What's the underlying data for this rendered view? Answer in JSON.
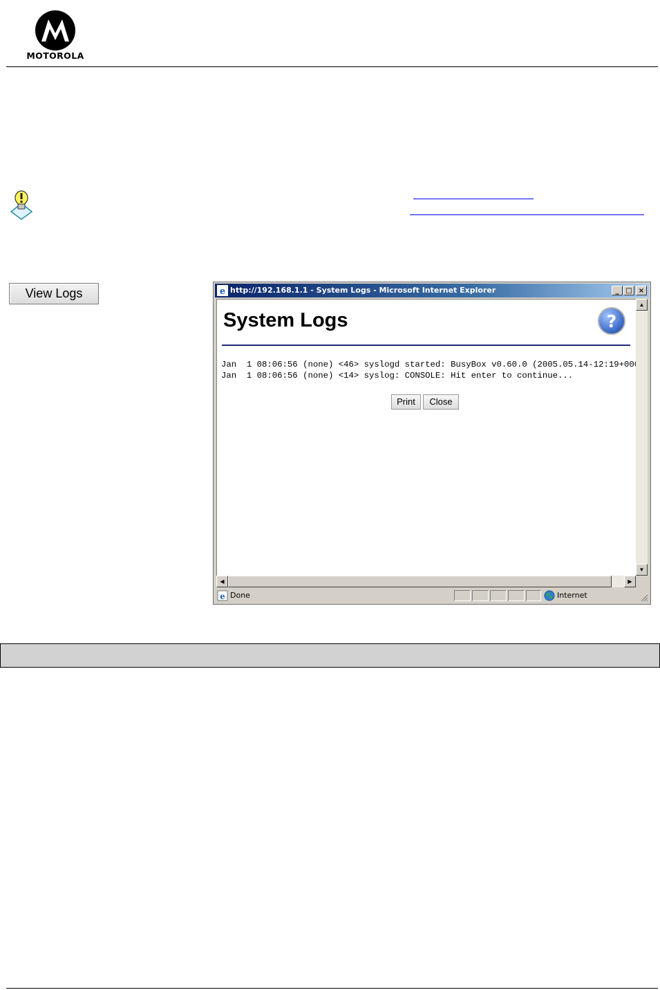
{
  "brand": {
    "name": "MOTOROLA"
  },
  "view_logs_button": {
    "label": "View Logs"
  },
  "browser_window": {
    "title": "http://192.168.1.1 - System Logs - Microsoft Internet Explorer",
    "controls": {
      "minimize": "_",
      "maximize": "□",
      "close": "×"
    },
    "page": {
      "heading": "System Logs",
      "log_lines": [
        "Jan  1 08:06:56 (none) <46> syslogd started: BusyBox v0.60.0 (2005.05.14-12:19+0000",
        "Jan  1 08:06:56 (none) <14> syslog: CONSOLE: Hit enter to continue..."
      ],
      "print_button": "Print",
      "close_button": "Close"
    },
    "scrollbars": {
      "up": "▲",
      "down": "▼",
      "left": "◀",
      "right": "▶"
    },
    "status_bar": {
      "status_text": "Done",
      "zone_text": "Internet"
    }
  },
  "colors": {
    "title_bar_start": "#0a246a",
    "title_bar_end": "#a6caf0",
    "heading_rule": "#1c2a7e",
    "link_underline": "#0000ee",
    "gray_bar": "#d2d2d2"
  }
}
